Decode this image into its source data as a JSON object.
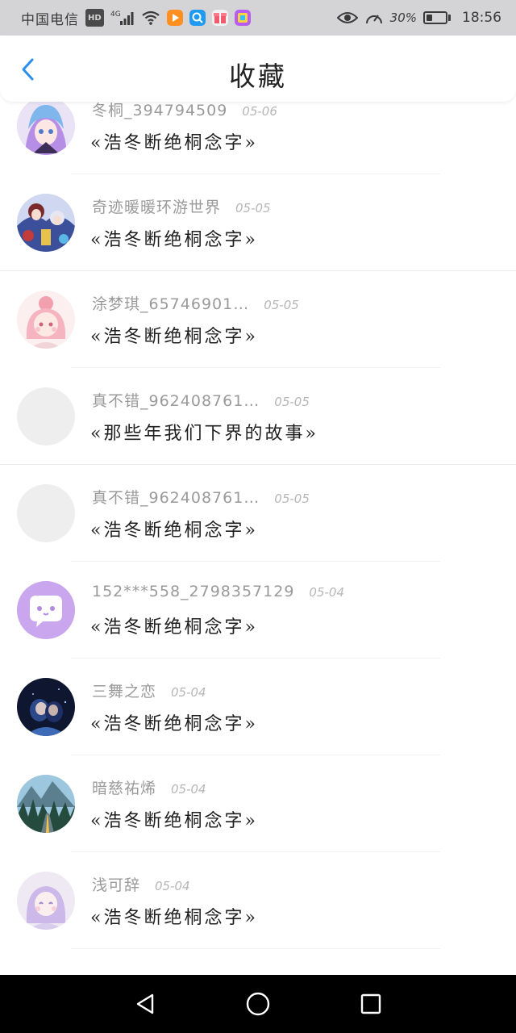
{
  "status_bar": {
    "carrier": "中国电信",
    "hd": "HD",
    "network": "4G",
    "battery_percent": "30%",
    "battery_level": 0.3,
    "time": "18:56"
  },
  "header": {
    "title": "收藏"
  },
  "items": [
    {
      "username": "冬桐_394794509",
      "date": "05-06",
      "quote": "«浩冬断绝桐念字»",
      "avatar": "anime-girl-purple-hair"
    },
    {
      "username": "奇迹暖暖环游世界",
      "date": "05-05",
      "quote": "«浩冬断绝桐念字»",
      "avatar": "anime-group"
    },
    {
      "username": "涂梦琪_65746901…",
      "date": "05-05",
      "quote": "«浩冬断绝桐念字»",
      "avatar": "anime-girl-pink"
    },
    {
      "username": "真不错_962408761…",
      "date": "05-05",
      "quote": "«那些年我们下界的故事»",
      "avatar": "blank-avatar"
    },
    {
      "username": "真不错_962408761…",
      "date": "05-05",
      "quote": "«浩冬断绝桐念字»",
      "avatar": "blank-avatar"
    },
    {
      "username": "152***558_2798357129",
      "date": "05-04",
      "quote": "«浩冬断绝桐念字»",
      "avatar": "chat-bubble-avatar"
    },
    {
      "username": "三舞之恋",
      "date": "05-04",
      "quote": "«浩冬断绝桐念字»",
      "avatar": "couple-night-photo"
    },
    {
      "username": "暗慈祐烯",
      "date": "05-04",
      "quote": "«浩冬断绝桐念字»",
      "avatar": "mountain-road-photo"
    },
    {
      "username": "浅可辞",
      "date": "05-04",
      "quote": "«浩冬断绝桐念字»",
      "avatar": "anime-girl-pastel"
    }
  ]
}
